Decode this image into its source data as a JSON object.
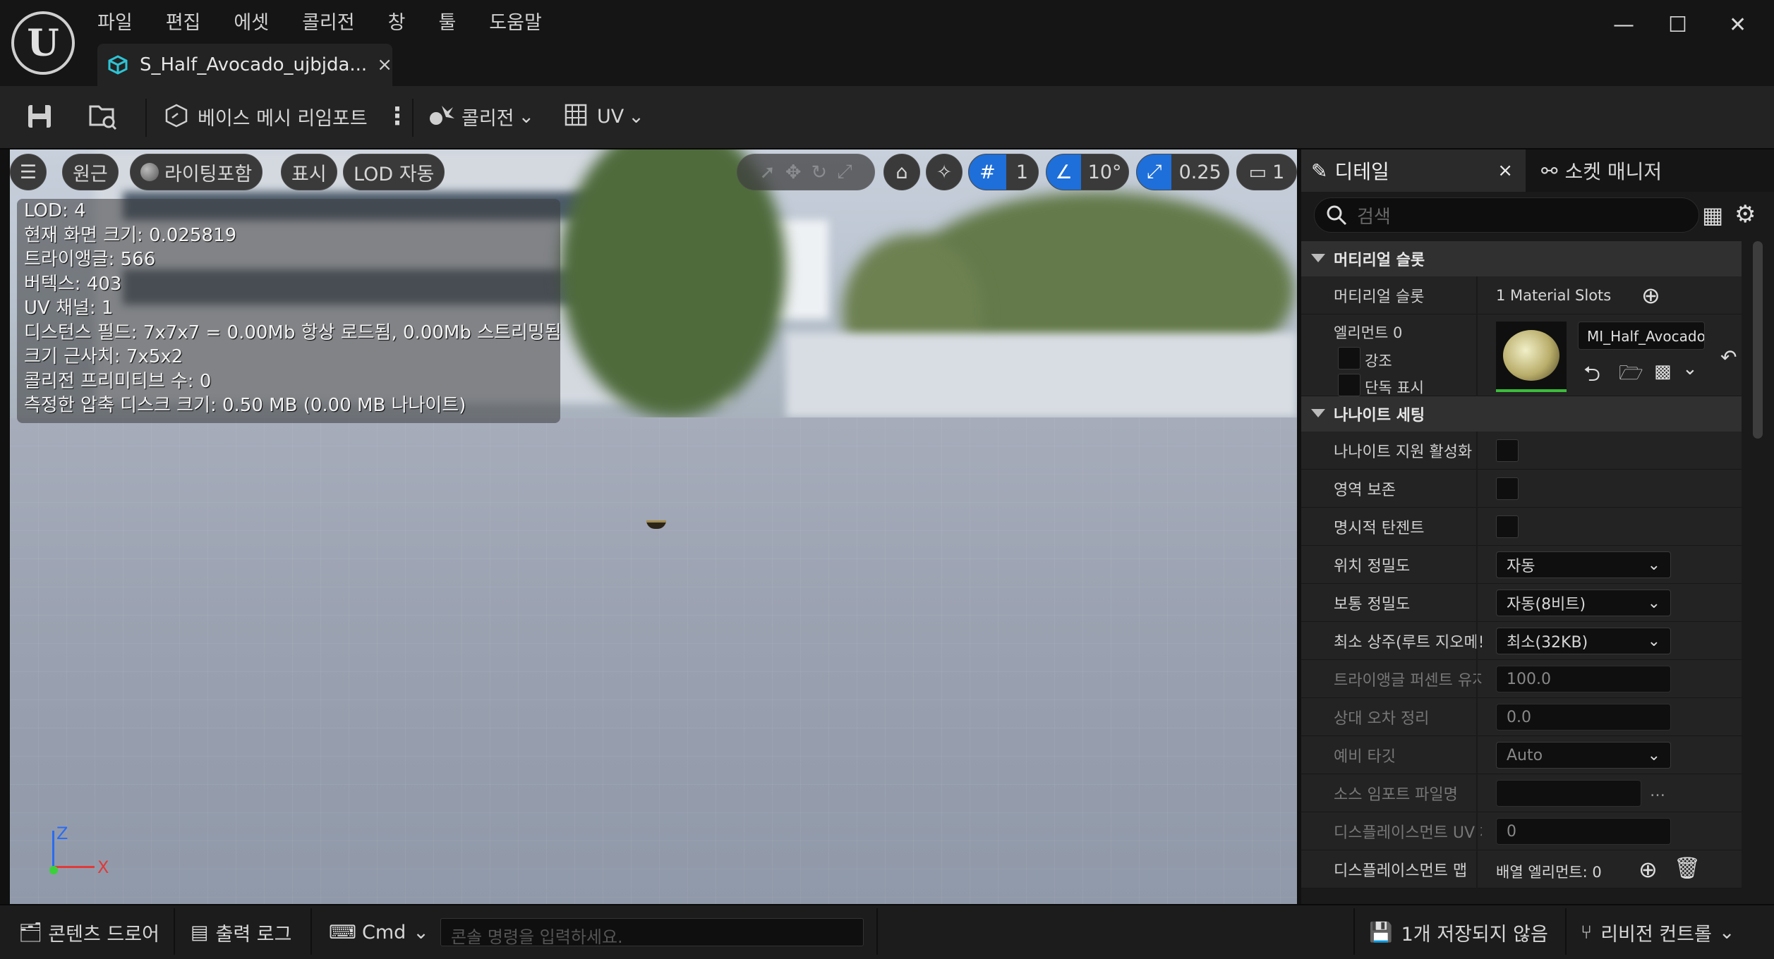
{
  "menu": [
    "파일",
    "편집",
    "에셋",
    "콜리전",
    "창",
    "툴",
    "도움말"
  ],
  "tab": {
    "title": "S_Half_Avocado_ujbjda...",
    "close": "×"
  },
  "window": {
    "minimize": "—",
    "maximize": "☐",
    "close": "✕"
  },
  "toolbar": {
    "reimport": "베이스 메시 리임포트",
    "collision": "콜리전",
    "uv": "UV"
  },
  "viewport": {
    "perspective": "원근",
    "lighting": "라이팅포함",
    "show": "표시",
    "lod": "LOD 자동",
    "grid_value": "1",
    "angle_value": "10°",
    "scale_value": "0.25",
    "camera_value": "1",
    "axis": {
      "z": "Z",
      "x": "X"
    },
    "stats": [
      "LOD:  4",
      "현재 화면 크기: 0.025819",
      "트라이앵글: 566",
      "버텍스: 403",
      "UV 채널:  1",
      "디스턴스 필드:  7x7x7 = 0.00Mb 항상 로드됨, 0.00Mb 스트리밍됨",
      "크기 근사치: 7x5x2",
      "콜리전 프리미티브 수: 0",
      "측정한 압축 디스크 크기: 0.50 MB (0.00 MB 나나이트)"
    ]
  },
  "details": {
    "tab_details": "디테일",
    "tab_close": "×",
    "tab_socket": "소켓 매니저",
    "search_placeholder": "검색",
    "section_material": "머티리얼 슬롯",
    "material_slots_label": "머티리얼 슬롯",
    "material_slots_value": "1 Material Slots",
    "element_label": "엘리먼트 0",
    "highlight": "강조",
    "isolate": "단독 표시",
    "material_name": "MI_Half_Avocado",
    "section_nanite": "나나이트 세팅",
    "rows": [
      {
        "label": "나나이트 지원 활성화",
        "type": "check",
        "dim": false
      },
      {
        "label": "영역 보존",
        "type": "check",
        "dim": false
      },
      {
        "label": "명시적 탄젠트",
        "type": "check",
        "dim": false
      },
      {
        "label": "위치 정밀도",
        "type": "dropdown",
        "value": "자동",
        "dim": false
      },
      {
        "label": "보통 정밀도",
        "type": "dropdown",
        "value": "자동(8비트)",
        "dim": false
      },
      {
        "label": "최소 상주(루트 지오메!",
        "type": "dropdown",
        "value": "최소(32KB)",
        "dim": false
      },
      {
        "label": "트라이앵글 퍼센트 유지",
        "type": "text",
        "value": "100.0",
        "dim": true
      },
      {
        "label": "상대 오차 정리",
        "type": "text",
        "value": "0.0",
        "dim": true
      },
      {
        "label": "예비 타깃",
        "type": "dropdown",
        "value": "Auto",
        "dim": true
      },
      {
        "label": "소스 임포트 파일명",
        "type": "file",
        "value": "",
        "dim": true
      },
      {
        "label": "디스플레이스먼트 UV 채",
        "type": "text",
        "value": "0",
        "dim": true
      },
      {
        "label": "디스플레이스먼트 맵",
        "type": "array",
        "value": "배열 엘리먼트: 0",
        "dim": false
      }
    ]
  },
  "statusbar": {
    "content_drawer": "콘텐츠 드로어",
    "output_log": "출력 로그",
    "cmd": "Cmd",
    "console_placeholder": "콘솔 명령을 입력하세요.",
    "unsaved": "1개 저장되지 않음",
    "revision": "리비전 컨트롤"
  },
  "colors": {
    "accent": "#1e6fd9",
    "panel": "#1a1a1a",
    "cyan_icon": "#2ec4d6"
  }
}
